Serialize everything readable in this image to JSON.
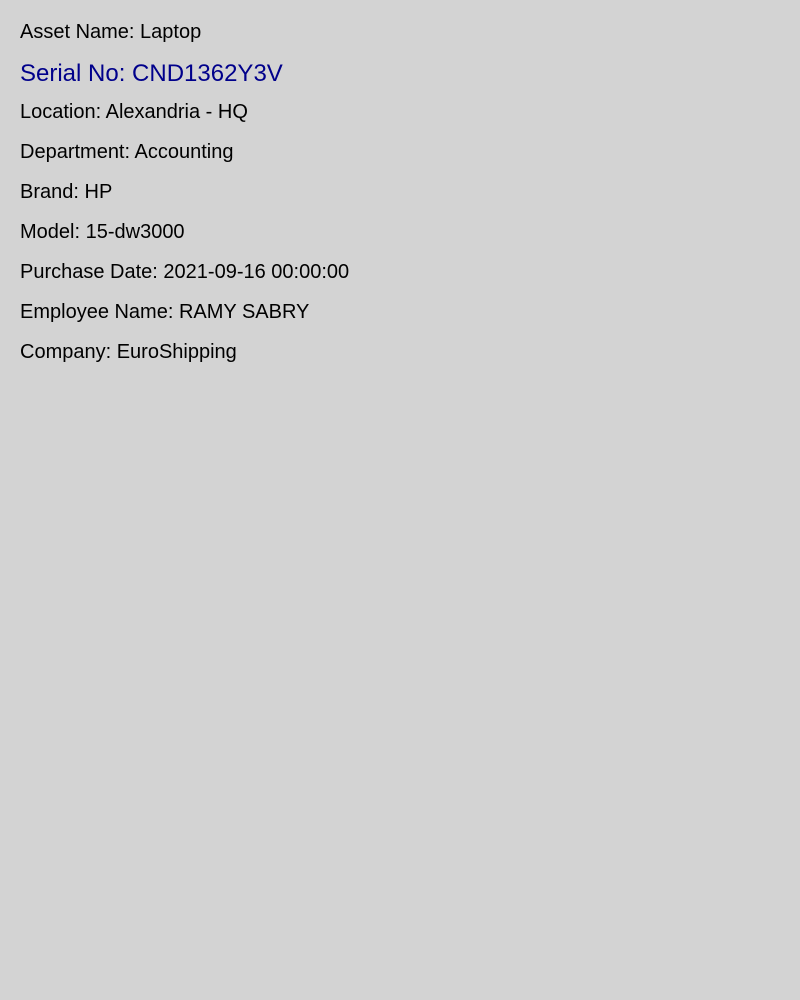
{
  "asset": {
    "asset_name": {
      "label": "Asset Name:",
      "value": "Laptop"
    },
    "serial_no": {
      "label": "Serial No:",
      "value": "CND1362Y3V"
    },
    "location": {
      "label": "Location:",
      "value": "Alexandria - HQ"
    },
    "department": {
      "label": "Department:",
      "value": "Accounting"
    },
    "brand": {
      "label": "Brand:",
      "value": "HP"
    },
    "model": {
      "label": "Model:",
      "value": "15-dw3000"
    },
    "purchase_date": {
      "label": "Purchase Date:",
      "value": "2021-09-16 00:00:00"
    },
    "employee_name": {
      "label": "Employee Name:",
      "value": "RAMY SABRY"
    },
    "company": {
      "label": "Company:",
      "value": "EuroShipping"
    }
  },
  "colors": {
    "background": "#d3d3d3",
    "text": "#000000",
    "serial_accent": "#00008b"
  }
}
